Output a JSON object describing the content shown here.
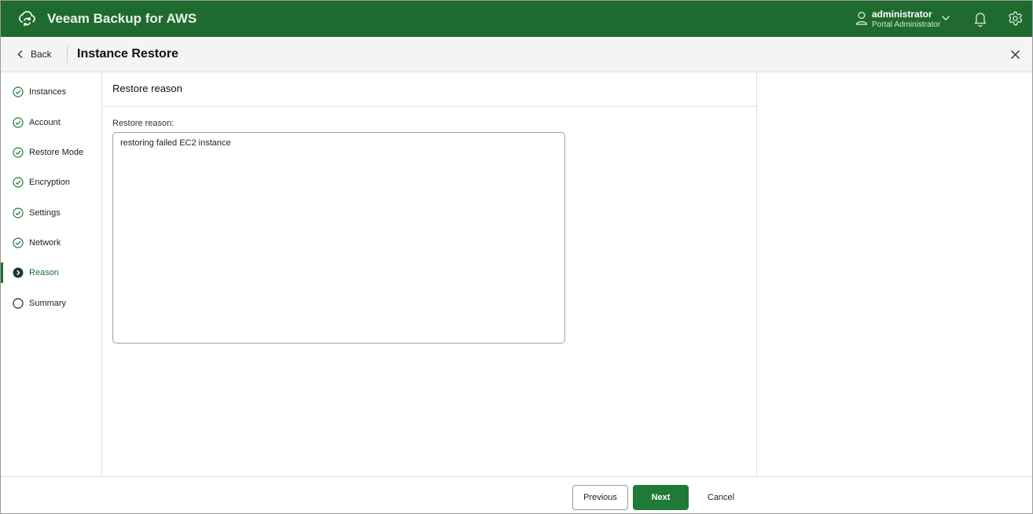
{
  "app": {
    "title": "Veeam Backup for AWS",
    "logo_icon": "cloud-sync-icon",
    "brand_color": "#1f6b2f"
  },
  "user": {
    "name": "administrator",
    "role": "Portal Administrator"
  },
  "subheader": {
    "back_label": "Back",
    "title": "Instance Restore"
  },
  "steps": [
    {
      "label": "Instances",
      "state": "done"
    },
    {
      "label": "Account",
      "state": "done"
    },
    {
      "label": "Restore Mode",
      "state": "done"
    },
    {
      "label": "Encryption",
      "state": "done"
    },
    {
      "label": "Settings",
      "state": "done"
    },
    {
      "label": "Network",
      "state": "done"
    },
    {
      "label": "Reason",
      "state": "active"
    },
    {
      "label": "Summary",
      "state": "pending"
    }
  ],
  "main": {
    "section_title": "Restore reason",
    "field_label": "Restore reason:",
    "reason_value": "restoring failed EC2 instance"
  },
  "footer": {
    "previous_label": "Previous",
    "next_label": "Next",
    "cancel_label": "Cancel"
  },
  "colors": {
    "accent": "#1d6e32",
    "primary_button": "#1f7a37"
  }
}
